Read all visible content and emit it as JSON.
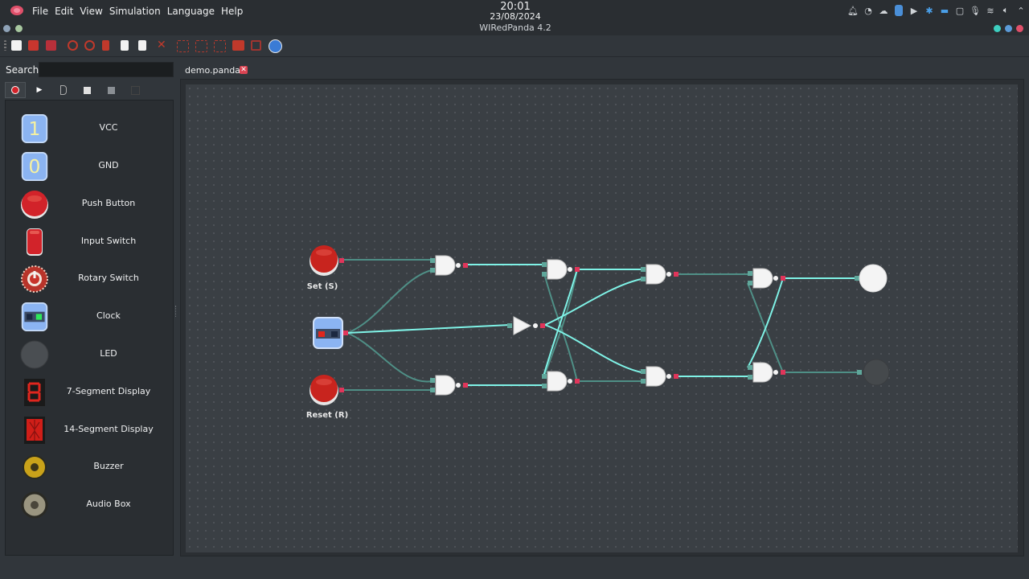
{
  "menubar": {
    "items": [
      "File",
      "Edit",
      "View",
      "Simulation",
      "Language",
      "Help"
    ]
  },
  "system": {
    "time": "20:01",
    "date": "23/08/2024",
    "window_title": "WIRedPanda 4.2"
  },
  "search": {
    "label": "Search:",
    "value": ""
  },
  "palette": {
    "items": [
      {
        "label": "VCC",
        "icon": "vcc-icon"
      },
      {
        "label": "GND",
        "icon": "gnd-icon"
      },
      {
        "label": "Push Button",
        "icon": "push-button-icon"
      },
      {
        "label": "Input Switch",
        "icon": "input-switch-icon"
      },
      {
        "label": "Rotary Switch",
        "icon": "rotary-switch-icon"
      },
      {
        "label": "Clock",
        "icon": "clock-icon"
      },
      {
        "label": "LED",
        "icon": "led-icon"
      },
      {
        "label": "7-Segment Display",
        "icon": "seven-segment-icon"
      },
      {
        "label": "14-Segment Display",
        "icon": "fourteen-segment-icon"
      },
      {
        "label": "Buzzer",
        "icon": "buzzer-icon"
      },
      {
        "label": "Audio Box",
        "icon": "audio-box-icon"
      }
    ],
    "vcc_glyph": "1",
    "gnd_glyph": "0"
  },
  "document": {
    "tab_label": "demo.panda"
  },
  "circuit": {
    "set_label": "Set (S)",
    "reset_label": "Reset (R)",
    "led_top_state": "on",
    "led_bottom_state": "off"
  },
  "colors": {
    "accent_red": "#da4453",
    "wire_active": "#7ff2e6",
    "wire_idle": "#4f8f86",
    "port_in": "#5fa79b",
    "port_out": "#e0355a"
  }
}
